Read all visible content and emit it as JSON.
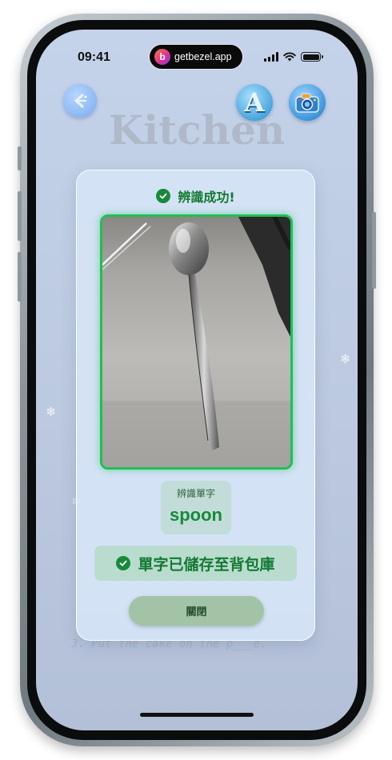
{
  "status_bar": {
    "time": "09:41",
    "island_text": "getbezel.app",
    "island_logo_letter": "b",
    "icons": [
      "signal-icon",
      "wifi-icon",
      "battery-icon"
    ]
  },
  "toolbar": {
    "back_icon": "back-arrow-icon",
    "font_button_glyph": "A",
    "camera_icon": "camera-icon"
  },
  "background": {
    "page_title": "Kitchen",
    "hint_text": "3. Put the cake on the p___e."
  },
  "result_dialog": {
    "title": "辨識成功!",
    "photo_subject": "spoon",
    "word_caption": "辨識單字",
    "word": "spoon",
    "saved_message": "單字已儲存至背包庫",
    "close_label": "關閉",
    "colors": {
      "success_green": "#178a3a",
      "frame_green": "#1fbf55",
      "card_background": "#d6e4f7"
    }
  }
}
